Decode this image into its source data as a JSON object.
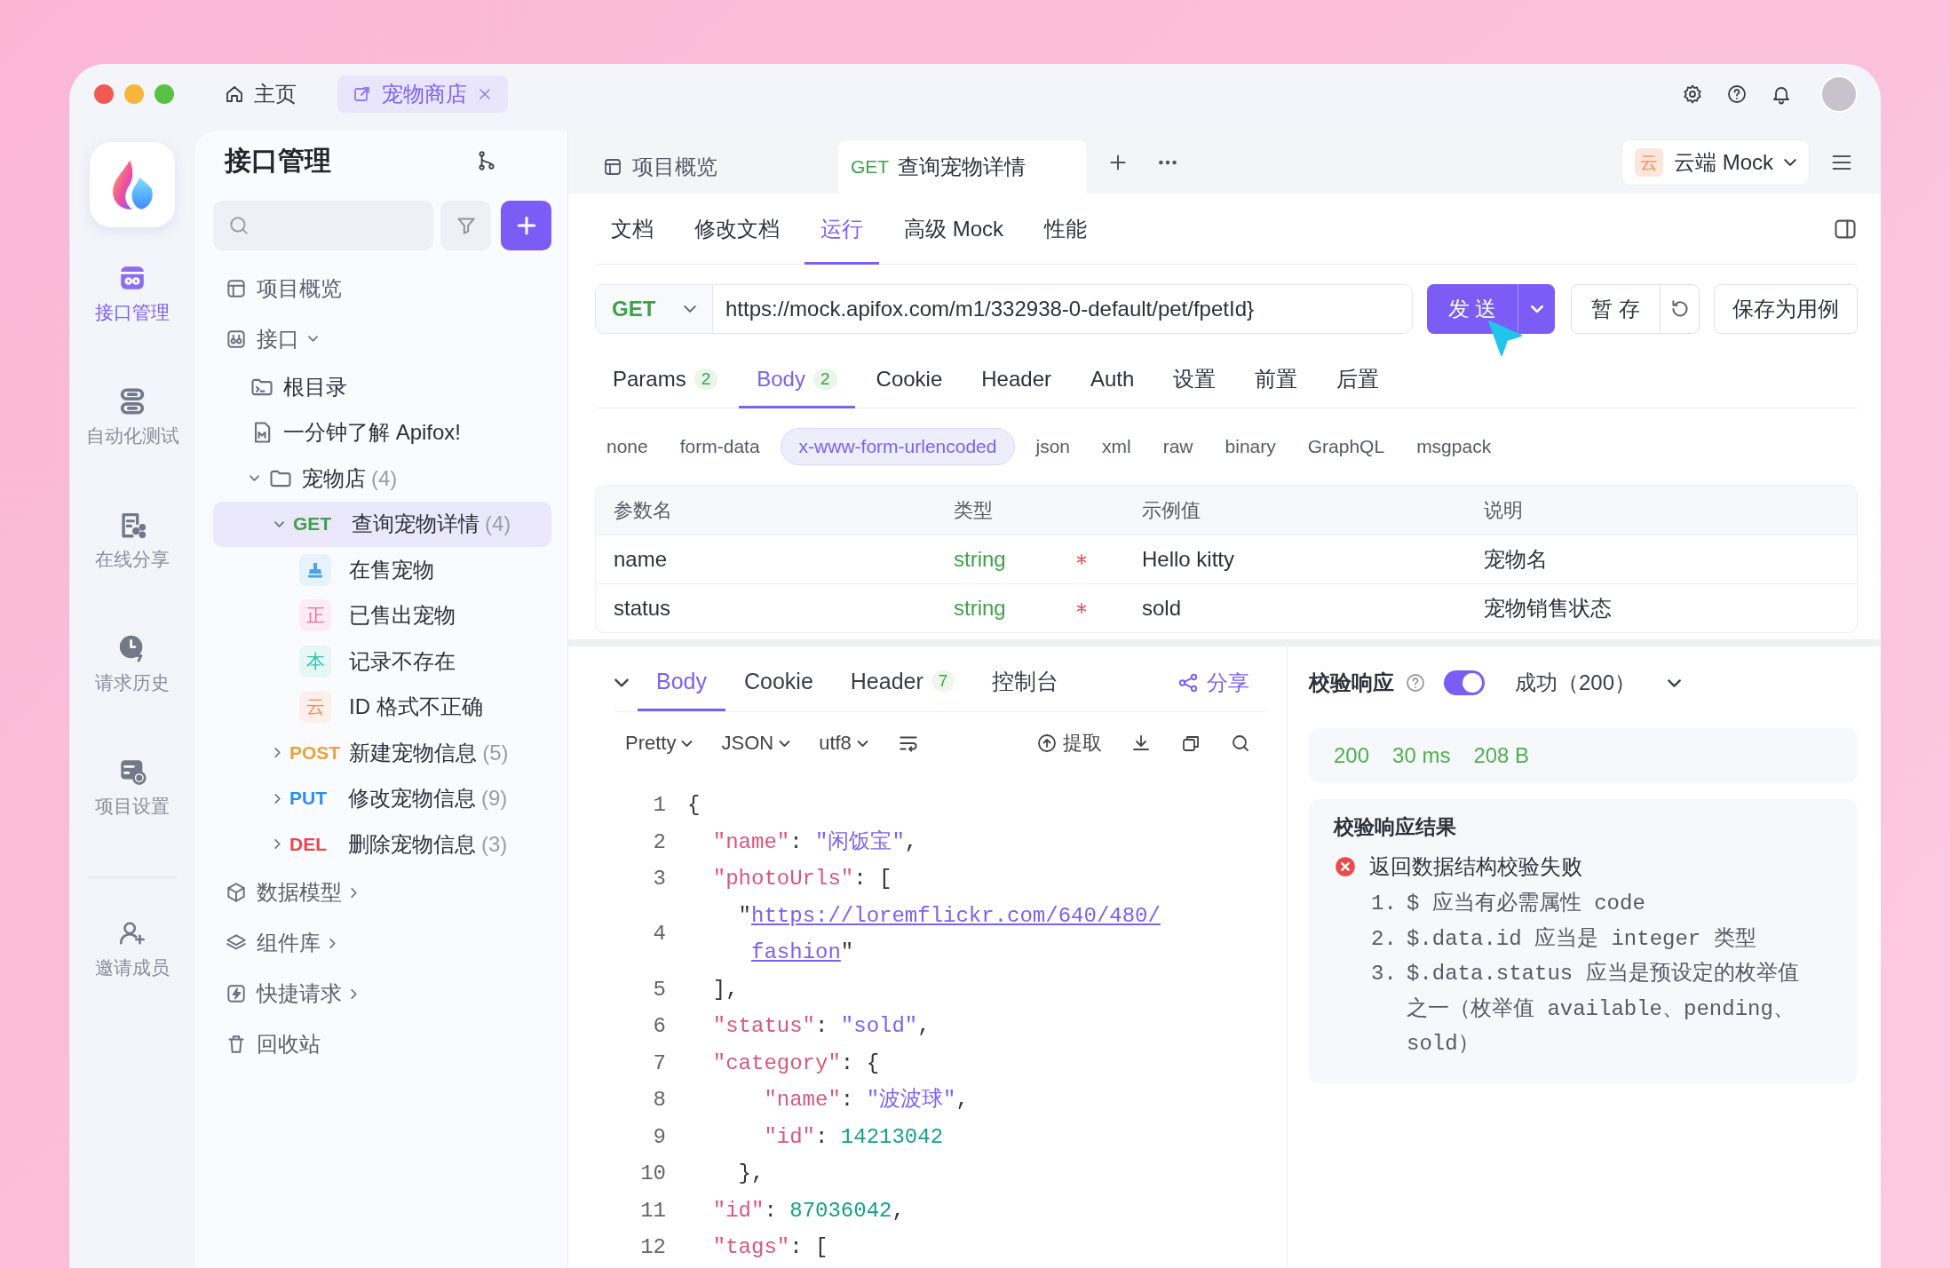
{
  "title_bar": {
    "tabs": [
      {
        "label": "主页",
        "selected": false
      },
      {
        "label": "宠物商店",
        "selected": true
      }
    ]
  },
  "rail": {
    "items": [
      {
        "label": "接口管理",
        "selected": true
      },
      {
        "label": "自动化测试",
        "selected": false
      },
      {
        "label": "在线分享",
        "selected": false
      },
      {
        "label": "请求历史",
        "selected": false
      },
      {
        "label": "项目设置",
        "selected": false
      },
      {
        "label": "邀请成员",
        "selected": false
      }
    ]
  },
  "tree_panel": {
    "title": "接口管理",
    "items": [
      {
        "kind": "page",
        "label": "项目概览",
        "selected": false
      },
      {
        "kind": "group",
        "label": "接口",
        "expanded": true,
        "selected": false,
        "children": [
          {
            "kind": "folder",
            "label": "根目录",
            "selected": false
          },
          {
            "kind": "doc",
            "label": "一分钟了解 Apifox!",
            "selected": false
          },
          {
            "kind": "folder",
            "label": "宠物店",
            "count": "(4)",
            "expanded": true,
            "selected": false,
            "children": [
              {
                "kind": "endpoint",
                "method": "GET",
                "color": "#3fa14a",
                "label": "查询宠物详情",
                "count": "(4)",
                "expanded": true,
                "selected": true,
                "children": [
                  {
                    "kind": "case",
                    "color": "#4aa3e8",
                    "label": "在售宠物",
                    "selected": false
                  },
                  {
                    "kind": "case",
                    "badge": "正",
                    "color": "#ec6aa3",
                    "label": "已售出宠物",
                    "selected": false
                  },
                  {
                    "kind": "case",
                    "badge": "本",
                    "color": "#3cc3b0",
                    "label": "记录不存在",
                    "selected": false
                  },
                  {
                    "kind": "case",
                    "badge": "云",
                    "color": "#ef8a5a",
                    "label": "ID 格式不正确",
                    "selected": false
                  }
                ]
              },
              {
                "kind": "endpoint",
                "method": "POST",
                "color": "#e8a33a",
                "label": "新建宠物信息",
                "count": "(5)",
                "expanded": false,
                "selected": false
              },
              {
                "kind": "endpoint",
                "method": "PUT",
                "color": "#2b8ef0",
                "label": "修改宠物信息",
                "count": "(9)",
                "expanded": false,
                "selected": false
              },
              {
                "kind": "endpoint",
                "method": "DEL",
                "color": "#e5484d",
                "label": "删除宠物信息",
                "count": "(3)",
                "expanded": false,
                "selected": false
              }
            ]
          }
        ]
      },
      {
        "kind": "group",
        "label": "数据模型",
        "expanded": false,
        "selected": false
      },
      {
        "kind": "group",
        "label": "组件库",
        "expanded": false,
        "selected": false
      },
      {
        "kind": "group",
        "label": "快捷请求",
        "expanded": false,
        "selected": false
      },
      {
        "kind": "page",
        "label": "回收站",
        "selected": false
      }
    ]
  },
  "doc_tabs": [
    {
      "label": "项目概览",
      "selected": false
    },
    {
      "method": "GET",
      "color": "#3fa14a",
      "label": "查询宠物详情",
      "selected": true
    }
  ],
  "environment": {
    "badge": "云",
    "label": "云端 Mock"
  },
  "view_tabs": [
    {
      "label": "文档",
      "selected": false
    },
    {
      "label": "修改文档",
      "selected": false
    },
    {
      "label": "运行",
      "selected": true
    },
    {
      "label": "高级 Mock",
      "selected": false
    },
    {
      "label": "性能",
      "selected": false
    }
  ],
  "request": {
    "method": "GET",
    "color": "#3fa14a",
    "url": "https://mock.apifox.com/m1/332938-0-default/pet/fpetId}",
    "send": "发 送",
    "save": "暂 存",
    "save_case": "保存为用例"
  },
  "param_tabs": [
    {
      "label": "Params",
      "count": "2",
      "selected": false
    },
    {
      "label": "Body",
      "count": "2",
      "selected": true
    },
    {
      "label": "Cookie",
      "selected": false
    },
    {
      "label": "Header",
      "selected": false
    },
    {
      "label": "Auth",
      "selected": false
    },
    {
      "label": "设置",
      "selected": false
    },
    {
      "label": "前置",
      "selected": false
    },
    {
      "label": "后置",
      "selected": false
    }
  ],
  "body_types": [
    {
      "label": "none",
      "selected": false
    },
    {
      "label": "form-data",
      "selected": false
    },
    {
      "label": "x-www-form-urlencoded",
      "selected": true
    },
    {
      "label": "json",
      "selected": false
    },
    {
      "label": "xml",
      "selected": false
    },
    {
      "label": "raw",
      "selected": false
    },
    {
      "label": "binary",
      "selected": false
    },
    {
      "label": "GraphQL",
      "selected": false
    },
    {
      "label": "msgpack",
      "selected": false
    }
  ],
  "params_table": {
    "columns": [
      "参数名",
      "类型",
      "示例值",
      "说明"
    ],
    "rows": [
      {
        "name": "name",
        "type": "string",
        "required": true,
        "example": "Hello kitty",
        "description": "宠物名"
      },
      {
        "name": "status",
        "type": "string",
        "required": true,
        "example": "sold",
        "description": "宠物销售状态"
      }
    ]
  },
  "response": {
    "tabs": [
      {
        "label": "Body",
        "selected": true
      },
      {
        "label": "Cookie",
        "selected": false
      },
      {
        "label": "Header",
        "count": "7",
        "selected": false
      },
      {
        "label": "控制台",
        "selected": false
      }
    ],
    "share": "分享",
    "formats": [
      "Pretty",
      "JSON",
      "utf8"
    ],
    "extract": "提取",
    "code": [
      {
        "number": "1",
        "tokens": [
          {
            "kind": "punct",
            "text": "{"
          }
        ]
      },
      {
        "number": "2",
        "tokens": [
          {
            "kind": "key",
            "text": "  \"name\""
          },
          {
            "kind": "punct",
            "text": ": "
          },
          {
            "kind": "string",
            "text": "\"闲饭宝\""
          },
          {
            "kind": "punct",
            "text": ","
          }
        ]
      },
      {
        "number": "3",
        "tokens": [
          {
            "kind": "key",
            "text": "  \"photoUrls\""
          },
          {
            "kind": "punct",
            "text": ": ["
          }
        ]
      },
      {
        "number": "4",
        "tokens": [
          {
            "kind": "punct",
            "text": "    \""
          },
          {
            "kind": "link",
            "text": "https://loremflickr.com/640/480/fashion"
          },
          {
            "kind": "punct",
            "text": "\""
          }
        ]
      },
      {
        "number": "5",
        "tokens": [
          {
            "kind": "punct",
            "text": "  ],"
          }
        ]
      },
      {
        "number": "6",
        "tokens": [
          {
            "kind": "key",
            "text": "  \"status\""
          },
          {
            "kind": "punct",
            "text": ": "
          },
          {
            "kind": "string",
            "text": "\"sold\""
          },
          {
            "kind": "punct",
            "text": ","
          }
        ]
      },
      {
        "number": "7",
        "tokens": [
          {
            "kind": "key",
            "text": "  \"category\""
          },
          {
            "kind": "punct",
            "text": ": {"
          }
        ]
      },
      {
        "number": "8",
        "tokens": [
          {
            "kind": "key",
            "text": "      \"name\""
          },
          {
            "kind": "punct",
            "text": ": "
          },
          {
            "kind": "string",
            "text": "\"波波球\""
          },
          {
            "kind": "punct",
            "text": ","
          }
        ]
      },
      {
        "number": "9",
        "tokens": [
          {
            "kind": "key",
            "text": "      \"id\""
          },
          {
            "kind": "punct",
            "text": ": "
          },
          {
            "kind": "number",
            "text": "14213042"
          }
        ]
      },
      {
        "number": "10",
        "tokens": [
          {
            "kind": "punct",
            "text": "    },"
          }
        ]
      },
      {
        "number": "11",
        "tokens": [
          {
            "kind": "key",
            "text": "  \"id\""
          },
          {
            "kind": "punct",
            "text": ": "
          },
          {
            "kind": "number",
            "text": "87036042"
          },
          {
            "kind": "punct",
            "text": ","
          }
        ]
      },
      {
        "number": "12",
        "tokens": [
          {
            "kind": "key",
            "text": "  \"tags\""
          },
          {
            "kind": "punct",
            "text": ": ["
          }
        ]
      }
    ]
  },
  "validation": {
    "title": "校验响应",
    "enabled": true,
    "status": "成功（200）",
    "metrics": [
      "200",
      "30 ms",
      "208 B"
    ],
    "result": {
      "title": "校验响应结果",
      "error": "返回数据结构校验失败",
      "items": [
        {
          "number": "1.",
          "text": "$ 应当有必需属性 code"
        },
        {
          "number": "2.",
          "text": "$.data.id 应当是 integer 类型"
        },
        {
          "number": "3.",
          "text": "$.data.status 应当是预设定的枚举值之一（枚举值 available、pending、sold）"
        }
      ]
    }
  }
}
